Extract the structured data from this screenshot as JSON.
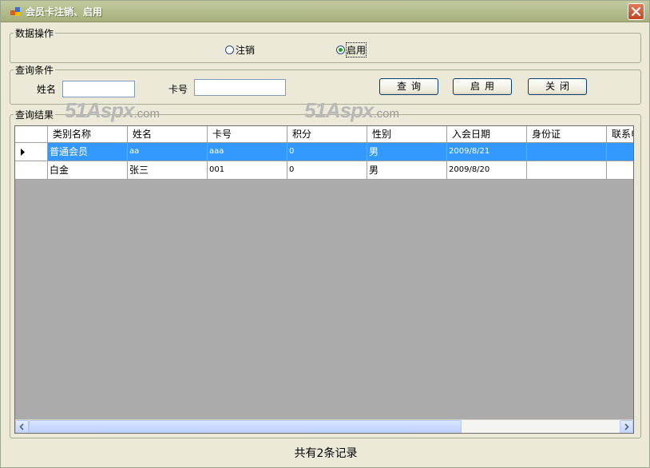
{
  "window": {
    "title": "会员卡注销、启用"
  },
  "ops_group": {
    "legend": "数据操作",
    "radios": [
      {
        "label": "注销",
        "checked": false
      },
      {
        "label": "启用",
        "checked": true
      }
    ]
  },
  "query_group": {
    "legend": "查询条件",
    "name_label": "姓名",
    "name_value": "",
    "card_label": "卡号",
    "card_value": "",
    "buttons": {
      "query": "查询",
      "enable": "启用",
      "close": "关闭"
    }
  },
  "result_group": {
    "legend": "查询结果"
  },
  "watermark": {
    "main": "51Aspx",
    "suffix": ".com"
  },
  "grid": {
    "columns": [
      "类别名称",
      "姓名",
      "卡号",
      "积分",
      "性别",
      "入会日期",
      "身份证",
      "联系电话"
    ],
    "rows": [
      [
        "普通会员",
        "aa",
        "aaa",
        "0",
        "男",
        "2009/8/21",
        "",
        ""
      ],
      [
        "白金",
        "张三",
        "001",
        "0",
        "男",
        "2009/8/20",
        "",
        ""
      ]
    ],
    "selected_row": 0
  },
  "status": {
    "text": "共有2条记录"
  },
  "colors": {
    "selection": "#3399ff",
    "grid_background": "#ababab",
    "window": "#ece9d8"
  }
}
